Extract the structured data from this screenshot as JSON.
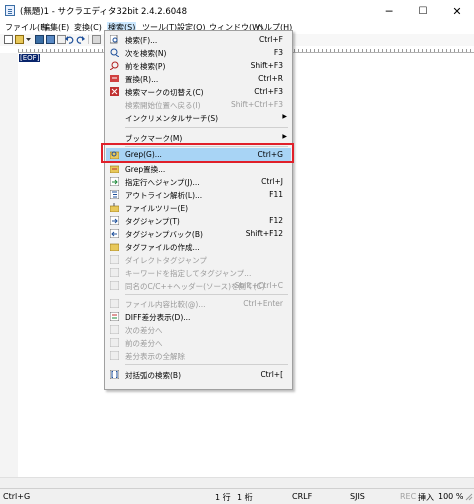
{
  "window": {
    "title": "(無題)1 - サクラエディタ32bit 2.4.2.6048",
    "minimize": "─",
    "maximize": "☐",
    "close": "✕"
  },
  "menubar": [
    "ファイル(F)",
    "編集(E)",
    "変換(C)",
    "検索(S)",
    "ツール(T)",
    "設定(O)",
    "ウィンドウ(W)",
    "ヘルプ(H)"
  ],
  "editor": {
    "eof": "[EOF]"
  },
  "search_menu": {
    "items": [
      {
        "label": "検索(F)...",
        "shortcut": "Ctrl+F"
      },
      {
        "label": "次を検索(N)",
        "shortcut": "F3"
      },
      {
        "label": "前を検索(P)",
        "shortcut": "Shift+F3"
      },
      {
        "label": "置換(R)...",
        "shortcut": "Ctrl+R"
      },
      {
        "label": "検索マークの切替え(C)",
        "shortcut": "Ctrl+F3"
      },
      {
        "label": "検索開始位置へ戻る(I)",
        "shortcut": "Shift+Ctrl+F3"
      },
      {
        "label": "インクリメンタルサーチ(S)",
        "shortcut": ""
      },
      {
        "label": "ブックマーク(M)",
        "shortcut": ""
      },
      {
        "label": "Grep(G)...",
        "shortcut": "Ctrl+G"
      },
      {
        "label": "Grep置換...",
        "shortcut": ""
      },
      {
        "label": "指定行へジャンプ(J)...",
        "shortcut": "Ctrl+J"
      },
      {
        "label": "アウトライン解析(L)...",
        "shortcut": "F11"
      },
      {
        "label": "ファイルツリー(E)",
        "shortcut": ""
      },
      {
        "label": "タグジャンプ(T)",
        "shortcut": "F12"
      },
      {
        "label": "タグジャンプバック(B)",
        "shortcut": "Shift+F12"
      },
      {
        "label": "タグファイルの作成...",
        "shortcut": ""
      },
      {
        "label": "ダイレクトタグジャンプ",
        "shortcut": ""
      },
      {
        "label": "キーワードを指定してタグジャンプ...",
        "shortcut": ""
      },
      {
        "label": "同名のC/C++ヘッダー(ソース)を開く(C)",
        "shortcut": "Shift+Ctrl+C"
      },
      {
        "label": "ファイル内容比較(@)...",
        "shortcut": "Ctrl+Enter"
      },
      {
        "label": "DIFF差分表示(D)...",
        "shortcut": ""
      },
      {
        "label": "次の差分へ",
        "shortcut": ""
      },
      {
        "label": "前の差分へ",
        "shortcut": ""
      },
      {
        "label": "差分表示の全解除",
        "shortcut": ""
      },
      {
        "label": "対括弧の検索(B)",
        "shortcut": "Ctrl+["
      }
    ]
  },
  "statusbar": {
    "hint": "Ctrl+G",
    "line": "1 行",
    "col": "1 桁",
    "eol": "CRLF",
    "encoding": "SJIS",
    "rec": "REC",
    "mode": "挿入",
    "zoom": "100 %"
  },
  "colors": {
    "highlight": "#a8d4f5",
    "annotation": "#e0202a",
    "eof_bg": "#08246b"
  }
}
